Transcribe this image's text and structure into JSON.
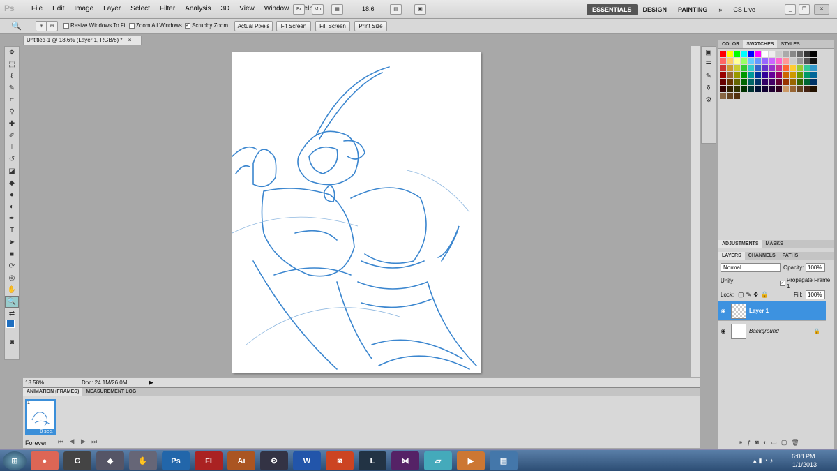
{
  "app": {
    "logo": "Ps"
  },
  "menu": [
    "File",
    "Edit",
    "Image",
    "Layer",
    "Select",
    "Filter",
    "Analysis",
    "3D",
    "View",
    "Window",
    "Help"
  ],
  "appbar": {
    "bridge": "Br",
    "minibridge": "Mb",
    "zoom": "18.6"
  },
  "workspaces": {
    "essentials": "ESSENTIALS",
    "design": "DESIGN",
    "painting": "PAINTING",
    "more": "»",
    "cslive": "CS Live"
  },
  "options": {
    "resize_windows": "Resize Windows To Fit",
    "zoom_all": "Zoom All Windows",
    "scrubby": "Scrubby Zoom",
    "actual_pixels": "Actual Pixels",
    "fit_screen": "Fit Screen",
    "fill_screen": "Fill Screen",
    "print_size": "Print Size"
  },
  "document": {
    "tab": "Untitled-1 @ 18.6% (Layer 1, RGB/8) *",
    "close": "×",
    "zoom_readout": "18.58%",
    "doc_size": "Doc: 24.1M/26.0M"
  },
  "animation": {
    "tabs": [
      "ANIMATION (FRAMES)",
      "MEASUREMENT LOG"
    ],
    "frame_number": "1",
    "frame_delay": "0 sec.",
    "loop": "Forever"
  },
  "color_panel": {
    "tabs": [
      "COLOR",
      "SWATCHES",
      "STYLES"
    ]
  },
  "adjust_panel": {
    "tabs": [
      "ADJUSTMENTS",
      "MASKS"
    ]
  },
  "layers_panel": {
    "tabs": [
      "LAYERS",
      "CHANNELS",
      "PATHS"
    ],
    "blend_mode": "Normal",
    "opacity_label": "Opacity:",
    "opacity": "100%",
    "unify_label": "Unify:",
    "propagate": "Propagate Frame 1",
    "lock_label": "Lock:",
    "fill_label": "Fill:",
    "fill": "100%",
    "layers": [
      {
        "name": "Layer 1"
      },
      {
        "name": "Background"
      }
    ]
  },
  "taskbar": {
    "time": "6:08 PM",
    "date": "1/1/2013",
    "apps": [
      "Firefox",
      "G",
      "Game",
      "Hand",
      "Ps",
      "Fl",
      "Ai",
      "Steam",
      "Word",
      "Office",
      "Lol",
      "VS",
      "Tool",
      "Media",
      "Photos"
    ]
  }
}
